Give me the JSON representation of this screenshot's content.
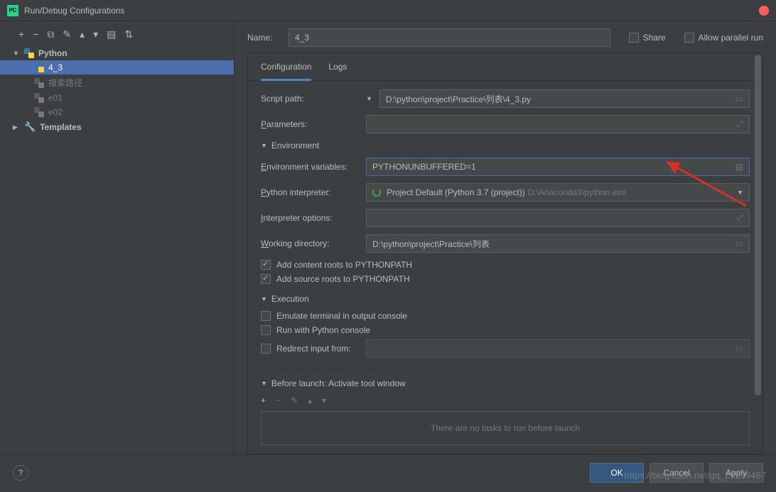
{
  "window": {
    "title": "Run/Debug Configurations"
  },
  "tree": {
    "python_label": "Python",
    "items": [
      {
        "label": "4_3",
        "selected": true
      },
      {
        "label": "搜索路径",
        "selected": false
      },
      {
        "label": "e01",
        "selected": false
      },
      {
        "label": "e02",
        "selected": false
      }
    ],
    "templates_label": "Templates"
  },
  "header": {
    "name_label": "Name:",
    "name_value": "4_3",
    "share_label": "Share",
    "allow_parallel_label": "Allow parallel run"
  },
  "tabs": {
    "configuration": "Configuration",
    "logs": "Logs"
  },
  "form": {
    "script_path_label": "Script path:",
    "script_path_value": "D:\\python\\project\\Practice\\列表\\4_3.py",
    "parameters_label": "Parameters:",
    "parameters_value": "",
    "environment_section": "Environment",
    "env_vars_label": "Environment variables:",
    "env_vars_value": "PYTHONUNBUFFERED=1",
    "interpreter_label": "Python interpreter:",
    "interpreter_value": "Project Default (Python 3.7 (project))",
    "interpreter_path": "D:\\Anaconda3\\python.exe",
    "interp_options_label": "Interpreter options:",
    "interp_options_value": "",
    "working_dir_label": "Working directory:",
    "working_dir_value": "D:\\python\\project\\Practice\\列表",
    "add_content_roots": "Add content roots to PYTHONPATH",
    "add_source_roots": "Add source roots to PYTHONPATH",
    "execution_section": "Execution",
    "emulate_terminal": "Emulate terminal in output console",
    "run_with_console": "Run with Python console",
    "redirect_input": "Redirect input from:",
    "before_launch_section": "Before launch: Activate tool window",
    "no_tasks": "There are no tasks to run before launch"
  },
  "footer": {
    "ok": "OK",
    "cancel": "Cancel",
    "apply": "Apply"
  },
  "watermark": "https://blog.csdn.net/qq_29339467"
}
